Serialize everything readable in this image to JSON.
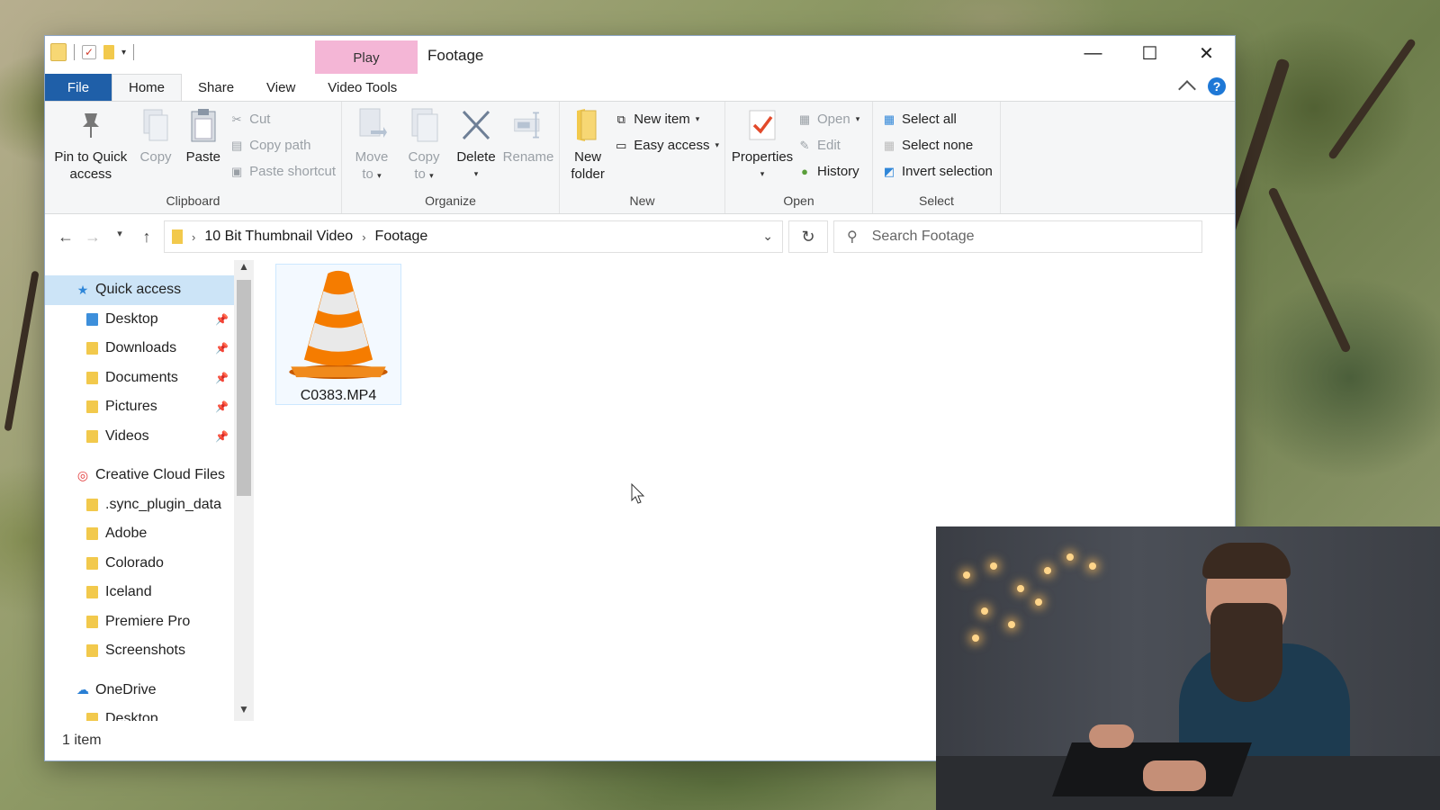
{
  "window": {
    "title": "Footage",
    "contextual_tab": "Play",
    "caption": {
      "minimize": "—",
      "maximize": "☐",
      "close": "✕"
    }
  },
  "ribbon_tabs": {
    "file": "File",
    "home": "Home",
    "share": "Share",
    "view": "View",
    "video_tools": "Video Tools"
  },
  "ribbon": {
    "clipboard": {
      "label": "Clipboard",
      "pin": [
        "Pin to Quick",
        "access"
      ],
      "copy": "Copy",
      "paste": "Paste",
      "cut": "Cut",
      "copy_path": "Copy path",
      "paste_shortcut": "Paste shortcut"
    },
    "organize": {
      "label": "Organize",
      "move": [
        "Move",
        "to"
      ],
      "copy": [
        "Copy",
        "to"
      ],
      "delete": "Delete",
      "rename": "Rename"
    },
    "new": {
      "label": "New",
      "new_folder": [
        "New",
        "folder"
      ],
      "new_item": "New item",
      "easy_access": "Easy access"
    },
    "open": {
      "label": "Open",
      "properties": "Properties",
      "open": "Open",
      "edit": "Edit",
      "history": "History"
    },
    "select": {
      "label": "Select",
      "select_all": "Select all",
      "select_none": "Select none",
      "invert": "Invert selection"
    }
  },
  "address": {
    "crumbs": [
      "10 Bit Thumbnail Video",
      "Footage"
    ],
    "search_placeholder": "Search Footage"
  },
  "nav": {
    "quick_access": "Quick access",
    "quick_items": [
      "Desktop",
      "Downloads",
      "Documents",
      "Pictures",
      "Videos"
    ],
    "creative_cloud": "Creative Cloud Files",
    "cc_items": [
      ".sync_plugin_data",
      "Adobe",
      "Colorado",
      "Iceland",
      "Premiere Pro",
      "Screenshots"
    ],
    "onedrive": "OneDrive",
    "onedrive_items": [
      "Desktop"
    ]
  },
  "files": [
    {
      "name": "C0383.MP4",
      "icon": "vlc-cone-icon"
    }
  ],
  "status": {
    "count": "1 item"
  },
  "colors": {
    "accent": "#1f5fa8",
    "contextual": "#f4b6d6",
    "selection": "#cce4f7",
    "help": "#1e78d6"
  }
}
